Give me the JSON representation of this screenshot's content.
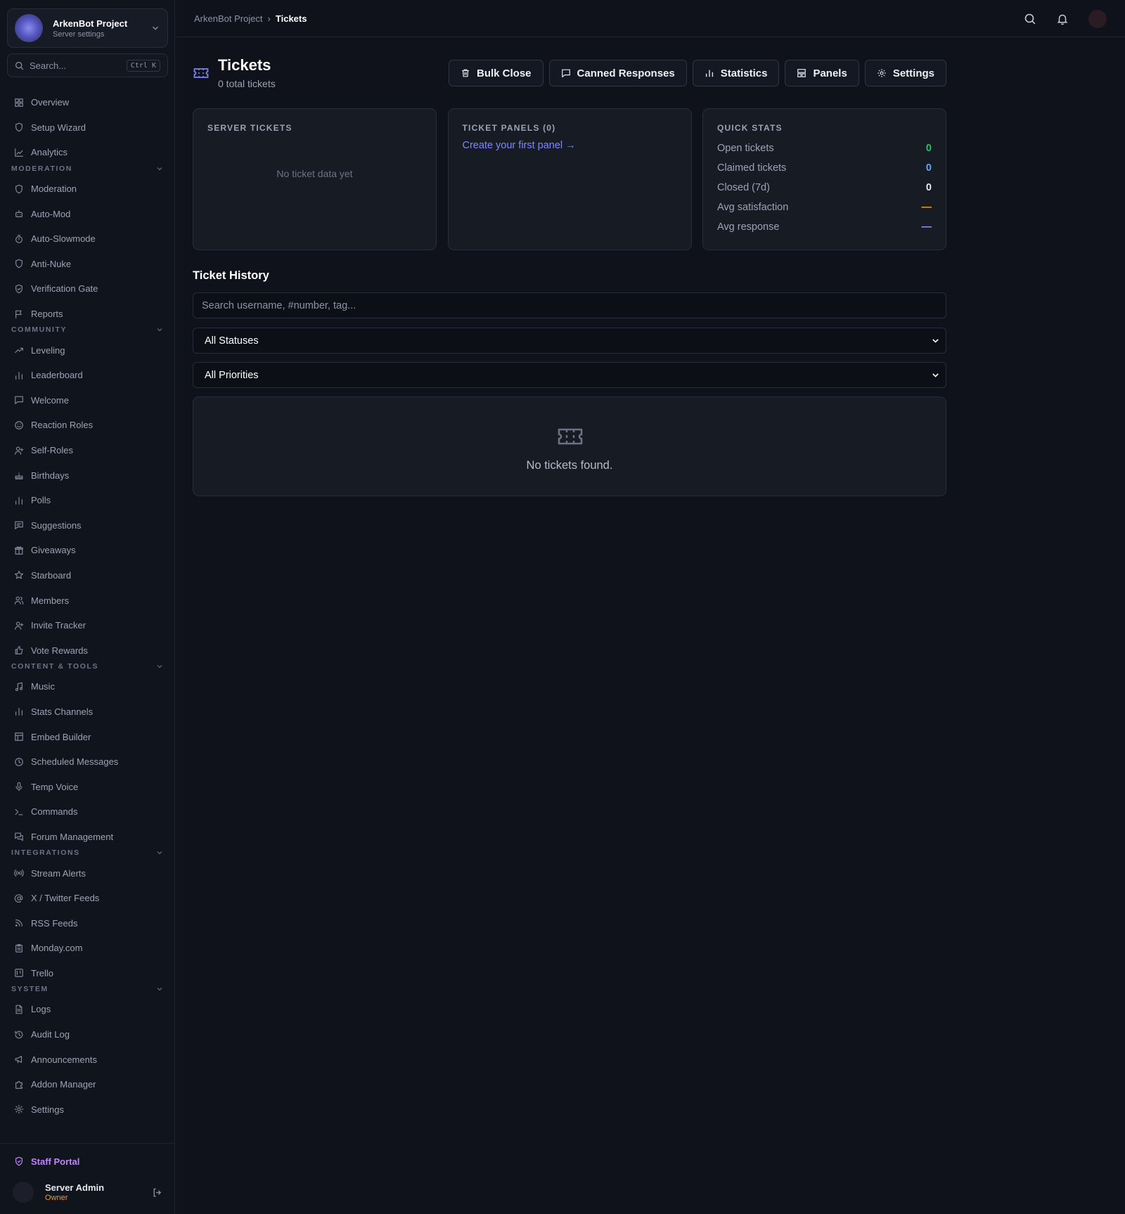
{
  "server": {
    "name": "ArkenBot Project",
    "subtitle": "Server settings"
  },
  "sidebar_search": {
    "placeholder": "Search...",
    "shortcut": "Ctrl K"
  },
  "nav": {
    "top": [
      {
        "label": "Overview",
        "icon": "grid-icon"
      },
      {
        "label": "Setup Wizard",
        "icon": "shield-icon"
      },
      {
        "label": "Analytics",
        "icon": "line-chart-icon"
      }
    ],
    "sections": [
      {
        "title": "MODERATION",
        "items": [
          {
            "label": "Moderation",
            "icon": "shield-icon"
          },
          {
            "label": "Auto-Mod",
            "icon": "bot-icon"
          },
          {
            "label": "Auto-Slowmode",
            "icon": "timer-icon"
          },
          {
            "label": "Anti-Nuke",
            "icon": "shield-icon"
          },
          {
            "label": "Verification Gate",
            "icon": "shield-check-icon"
          },
          {
            "label": "Reports",
            "icon": "flag-icon"
          }
        ]
      },
      {
        "title": "COMMUNITY",
        "items": [
          {
            "label": "Leveling",
            "icon": "trending-up-icon"
          },
          {
            "label": "Leaderboard",
            "icon": "bar-chart-icon"
          },
          {
            "label": "Welcome",
            "icon": "message-icon"
          },
          {
            "label": "Reaction Roles",
            "icon": "smile-icon"
          },
          {
            "label": "Self-Roles",
            "icon": "user-plus-icon"
          },
          {
            "label": "Birthdays",
            "icon": "cake-icon"
          },
          {
            "label": "Polls",
            "icon": "bar-chart-icon"
          },
          {
            "label": "Suggestions",
            "icon": "message-square-icon"
          },
          {
            "label": "Giveaways",
            "icon": "gift-icon"
          },
          {
            "label": "Starboard",
            "icon": "star-icon"
          },
          {
            "label": "Members",
            "icon": "users-icon"
          },
          {
            "label": "Invite Tracker",
            "icon": "user-plus-icon"
          },
          {
            "label": "Vote Rewards",
            "icon": "thumbs-up-icon"
          }
        ]
      },
      {
        "title": "CONTENT & TOOLS",
        "items": [
          {
            "label": "Music",
            "icon": "music-icon"
          },
          {
            "label": "Stats Channels",
            "icon": "bar-chart-icon"
          },
          {
            "label": "Embed Builder",
            "icon": "layout-icon"
          },
          {
            "label": "Scheduled Messages",
            "icon": "clock-icon"
          },
          {
            "label": "Temp Voice",
            "icon": "mic-icon"
          },
          {
            "label": "Commands",
            "icon": "terminal-icon"
          },
          {
            "label": "Forum Management",
            "icon": "messages-icon"
          }
        ]
      },
      {
        "title": "INTEGRATIONS",
        "items": [
          {
            "label": "Stream Alerts",
            "icon": "radio-icon"
          },
          {
            "label": "X / Twitter Feeds",
            "icon": "at-sign-icon"
          },
          {
            "label": "RSS Feeds",
            "icon": "rss-icon"
          },
          {
            "label": "Monday.com",
            "icon": "clipboard-icon"
          },
          {
            "label": "Trello",
            "icon": "trello-icon"
          }
        ]
      },
      {
        "title": "SYSTEM",
        "items": [
          {
            "label": "Logs",
            "icon": "file-icon"
          },
          {
            "label": "Audit Log",
            "icon": "history-icon"
          },
          {
            "label": "Announcements",
            "icon": "megaphone-icon"
          },
          {
            "label": "Addon Manager",
            "icon": "puzzle-icon"
          },
          {
            "label": "Settings",
            "icon": "gear-icon"
          }
        ]
      }
    ]
  },
  "staff_portal": {
    "label": "Staff Portal"
  },
  "user": {
    "name": "Server Admin",
    "role": "Owner"
  },
  "breadcrumb": {
    "parent": "ArkenBot Project",
    "separator": "›",
    "current": "Tickets"
  },
  "page": {
    "title": "Tickets",
    "subtitle": "0 total tickets"
  },
  "actions": [
    {
      "label": "Bulk Close",
      "icon": "trash-icon"
    },
    {
      "label": "Canned Responses",
      "icon": "message-icon"
    },
    {
      "label": "Statistics",
      "icon": "bar-chart-icon"
    },
    {
      "label": "Panels",
      "icon": "layout-icon"
    },
    {
      "label": "Settings",
      "icon": "gear-icon"
    }
  ],
  "cards": {
    "server_tickets": {
      "title": "SERVER TICKETS",
      "empty": "No ticket data yet"
    },
    "ticket_panels": {
      "title": "TICKET PANELS (0)",
      "link": "Create your first panel →"
    },
    "quick_stats": {
      "title": "QUICK STATS",
      "rows": [
        {
          "label": "Open tickets",
          "value": "0",
          "color": "#22c55e"
        },
        {
          "label": "Claimed tickets",
          "value": "0",
          "color": "#60a5fa"
        },
        {
          "label": "Closed (7d)",
          "value": "0",
          "color": "#e6e8ee"
        },
        {
          "label": "Avg satisfaction",
          "value": "—",
          "color": "#f59e0b"
        },
        {
          "label": "Avg response",
          "value": "—",
          "color": "#a78bfa"
        }
      ]
    }
  },
  "history": {
    "title": "Ticket History",
    "search_placeholder": "Search username, #number, tag...",
    "status_filter": "All Statuses",
    "priority_filter": "All Priorities",
    "empty_message": "No tickets found."
  },
  "colors": {
    "accent": "#7c83f5",
    "staff": "#c084fc",
    "owner": "#f59e0b"
  }
}
